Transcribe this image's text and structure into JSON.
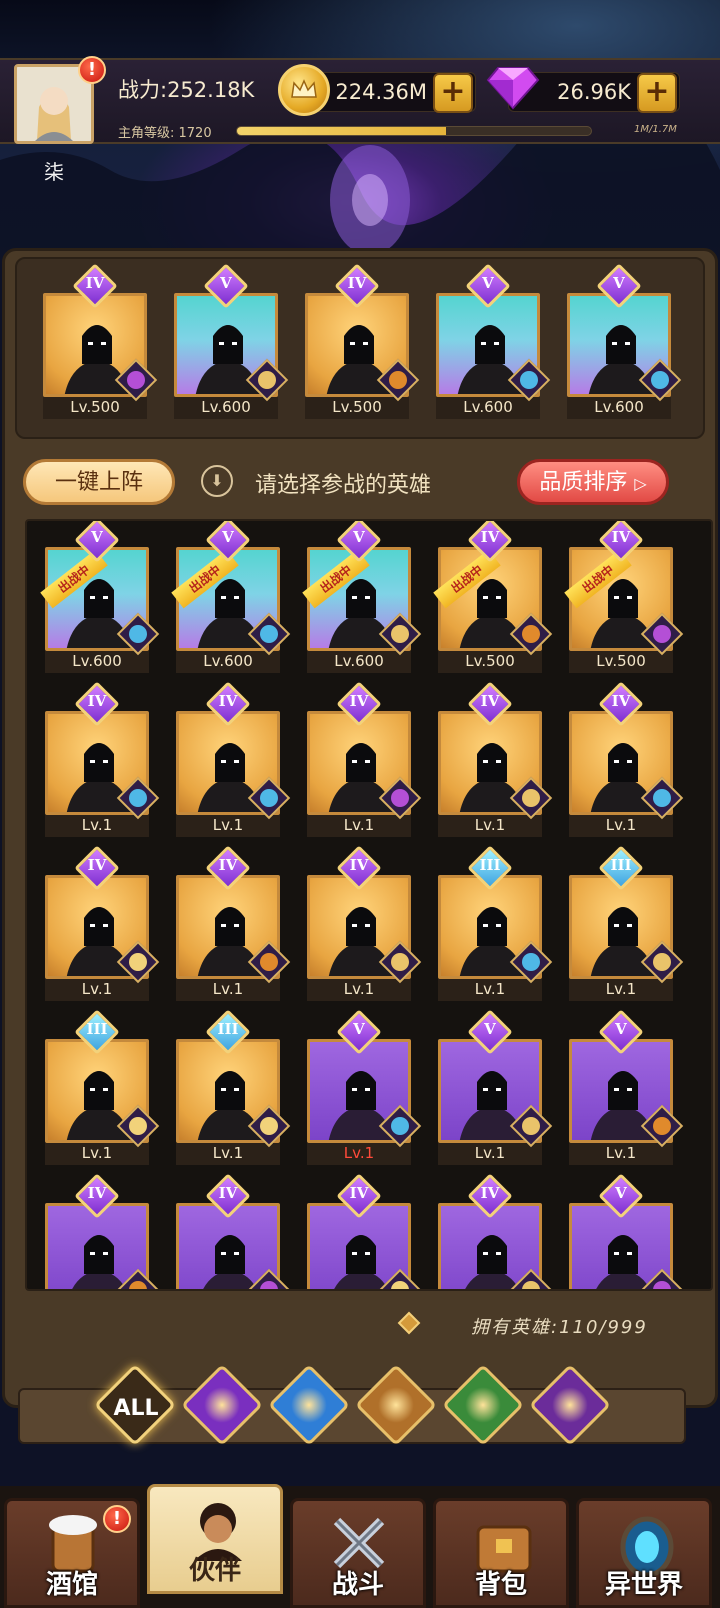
{
  "player": {
    "power_label": "战力:252.18K",
    "level_label": "主角等级: 1720",
    "xp_text": "1M/1.7M",
    "xp_fraction": 0.59,
    "name": "柒"
  },
  "currencies": {
    "gold": "224.36M",
    "gems": "26.96K"
  },
  "toolbar": {
    "auto_deploy": "一键上阵",
    "prompt": "请选择参战的英雄",
    "sort": "品质排序"
  },
  "team": [
    {
      "tier": "IV",
      "level": "Lv.500",
      "bg": "gold",
      "faction": "demon"
    },
    {
      "tier": "V",
      "level": "Lv.600",
      "bg": "cyan",
      "faction": "light"
    },
    {
      "tier": "IV",
      "level": "Lv.500",
      "bg": "gold",
      "faction": "beast"
    },
    {
      "tier": "V",
      "level": "Lv.600",
      "bg": "cyan",
      "faction": "sea"
    },
    {
      "tier": "V",
      "level": "Lv.600",
      "bg": "cyan",
      "faction": "sea"
    }
  ],
  "deployed_ribbon": "出战中",
  "roster": [
    {
      "tier": "V",
      "level": "Lv.600",
      "bg": "cyan",
      "faction": "sea",
      "deployed": true
    },
    {
      "tier": "V",
      "level": "Lv.600",
      "bg": "cyan",
      "faction": "sea",
      "deployed": true
    },
    {
      "tier": "V",
      "level": "Lv.600",
      "bg": "cyan",
      "faction": "light",
      "deployed": true
    },
    {
      "tier": "IV",
      "level": "Lv.500",
      "bg": "gold",
      "faction": "beast",
      "deployed": true
    },
    {
      "tier": "IV",
      "level": "Lv.500",
      "bg": "gold",
      "faction": "demon",
      "deployed": true
    },
    {
      "tier": "IV",
      "level": "Lv.1",
      "bg": "gold",
      "faction": "sea"
    },
    {
      "tier": "IV",
      "level": "Lv.1",
      "bg": "gold",
      "faction": "sea"
    },
    {
      "tier": "IV",
      "level": "Lv.1",
      "bg": "gold",
      "faction": "demon"
    },
    {
      "tier": "IV",
      "level": "Lv.1",
      "bg": "gold",
      "faction": "light"
    },
    {
      "tier": "IV",
      "level": "Lv.1",
      "bg": "gold",
      "faction": "sea"
    },
    {
      "tier": "IV",
      "level": "Lv.1",
      "bg": "gold",
      "faction": "elf"
    },
    {
      "tier": "IV",
      "level": "Lv.1",
      "bg": "gold",
      "faction": "beast"
    },
    {
      "tier": "IV",
      "level": "Lv.1",
      "bg": "gold",
      "faction": "light"
    },
    {
      "tier": "III",
      "level": "Lv.1",
      "bg": "gold",
      "faction": "sea"
    },
    {
      "tier": "III",
      "level": "Lv.1",
      "bg": "gold",
      "faction": "light"
    },
    {
      "tier": "III",
      "level": "Lv.1",
      "bg": "gold",
      "faction": "elf"
    },
    {
      "tier": "III",
      "level": "Lv.1",
      "bg": "gold",
      "faction": "elf"
    },
    {
      "tier": "V",
      "level": "Lv.1",
      "bg": "purple",
      "faction": "sea",
      "red": true
    },
    {
      "tier": "V",
      "level": "Lv.1",
      "bg": "purple",
      "faction": "light"
    },
    {
      "tier": "V",
      "level": "Lv.1",
      "bg": "purple",
      "faction": "beast"
    },
    {
      "tier": "IV",
      "level": "",
      "bg": "purple",
      "faction": "beast"
    },
    {
      "tier": "IV",
      "level": "",
      "bg": "purple",
      "faction": "demon"
    },
    {
      "tier": "IV",
      "level": "",
      "bg": "purple",
      "faction": "elf"
    },
    {
      "tier": "IV",
      "level": "",
      "bg": "purple",
      "faction": "light"
    },
    {
      "tier": "V",
      "level": "",
      "bg": "purple",
      "faction": "demon"
    }
  ],
  "owned_heroes": "拥有英雄:110/999",
  "filters": {
    "all_label": "ALL",
    "items": [
      "light-faction",
      "sea-faction",
      "beast-faction",
      "elf-faction",
      "demon-faction"
    ]
  },
  "nav": [
    {
      "label": "酒馆",
      "icon": "tavern-mug-icon",
      "alert": true
    },
    {
      "label": "伙伴",
      "icon": "partner-icon",
      "active": true
    },
    {
      "label": "战斗",
      "icon": "crossed-swords-icon"
    },
    {
      "label": "背包",
      "icon": "backpack-chest-icon"
    },
    {
      "label": "异世界",
      "icon": "portal-icon"
    }
  ],
  "colors": {
    "gold_bg": "#e8a541",
    "cyan_bg": "#55d4d0",
    "purple_bg": "#8a52d6",
    "level_red": "#ff4a3a",
    "sort_button": "#e24a45"
  }
}
